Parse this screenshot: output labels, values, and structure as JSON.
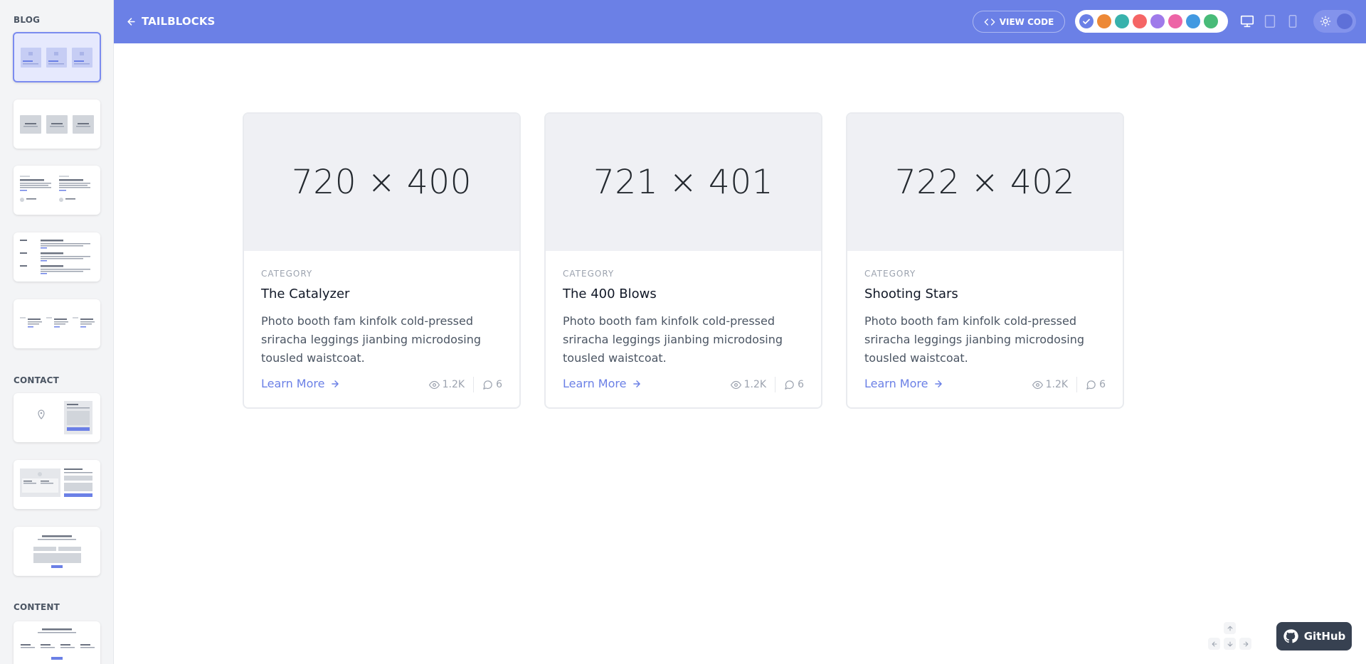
{
  "header": {
    "back_label": "TAILBLOCKS",
    "view_code_label": "VIEW CODE",
    "colors": [
      {
        "name": "indigo",
        "hex": "#6b80e6",
        "selected": true
      },
      {
        "name": "orange",
        "hex": "#ed8936",
        "selected": false
      },
      {
        "name": "teal",
        "hex": "#38b2ac",
        "selected": false
      },
      {
        "name": "red",
        "hex": "#f56565",
        "selected": false
      },
      {
        "name": "purple",
        "hex": "#9f7aea",
        "selected": false
      },
      {
        "name": "pink",
        "hex": "#ed64a6",
        "selected": false
      },
      {
        "name": "blue",
        "hex": "#4299e1",
        "selected": false
      },
      {
        "name": "green",
        "hex": "#48bb78",
        "selected": false
      }
    ],
    "devices": [
      "desktop-icon",
      "tablet-icon",
      "phone-icon"
    ],
    "theme_icon": "sun-icon"
  },
  "sidebar": {
    "sections": [
      {
        "title": "BLOG",
        "thumb_count": 5
      },
      {
        "title": "CONTACT",
        "thumb_count": 3
      },
      {
        "title": "CONTENT",
        "thumb_count": 1
      }
    ]
  },
  "cards": [
    {
      "image_label": "720 × 400",
      "category": "CATEGORY",
      "title": "The Catalyzer",
      "description": "Photo booth fam kinfolk cold-pressed sriracha leggings jianbing microdosing tousled waistcoat.",
      "link_label": "Learn More",
      "views": "1.2K",
      "comments": "6"
    },
    {
      "image_label": "721 × 401",
      "category": "CATEGORY",
      "title": "The 400 Blows",
      "description": "Photo booth fam kinfolk cold-pressed sriracha leggings jianbing microdosing tousled waistcoat.",
      "link_label": "Learn More",
      "views": "1.2K",
      "comments": "6"
    },
    {
      "image_label": "722 × 402",
      "category": "CATEGORY",
      "title": "Shooting Stars",
      "description": "Photo booth fam kinfolk cold-pressed sriracha leggings jianbing microdosing tousled waistcoat.",
      "link_label": "Learn More",
      "views": "1.2K",
      "comments": "6"
    }
  ],
  "footer": {
    "github_label": "GitHub",
    "keys": [
      "arrow-up-icon",
      "arrow-left-icon",
      "arrow-down-icon",
      "arrow-right-icon"
    ]
  }
}
